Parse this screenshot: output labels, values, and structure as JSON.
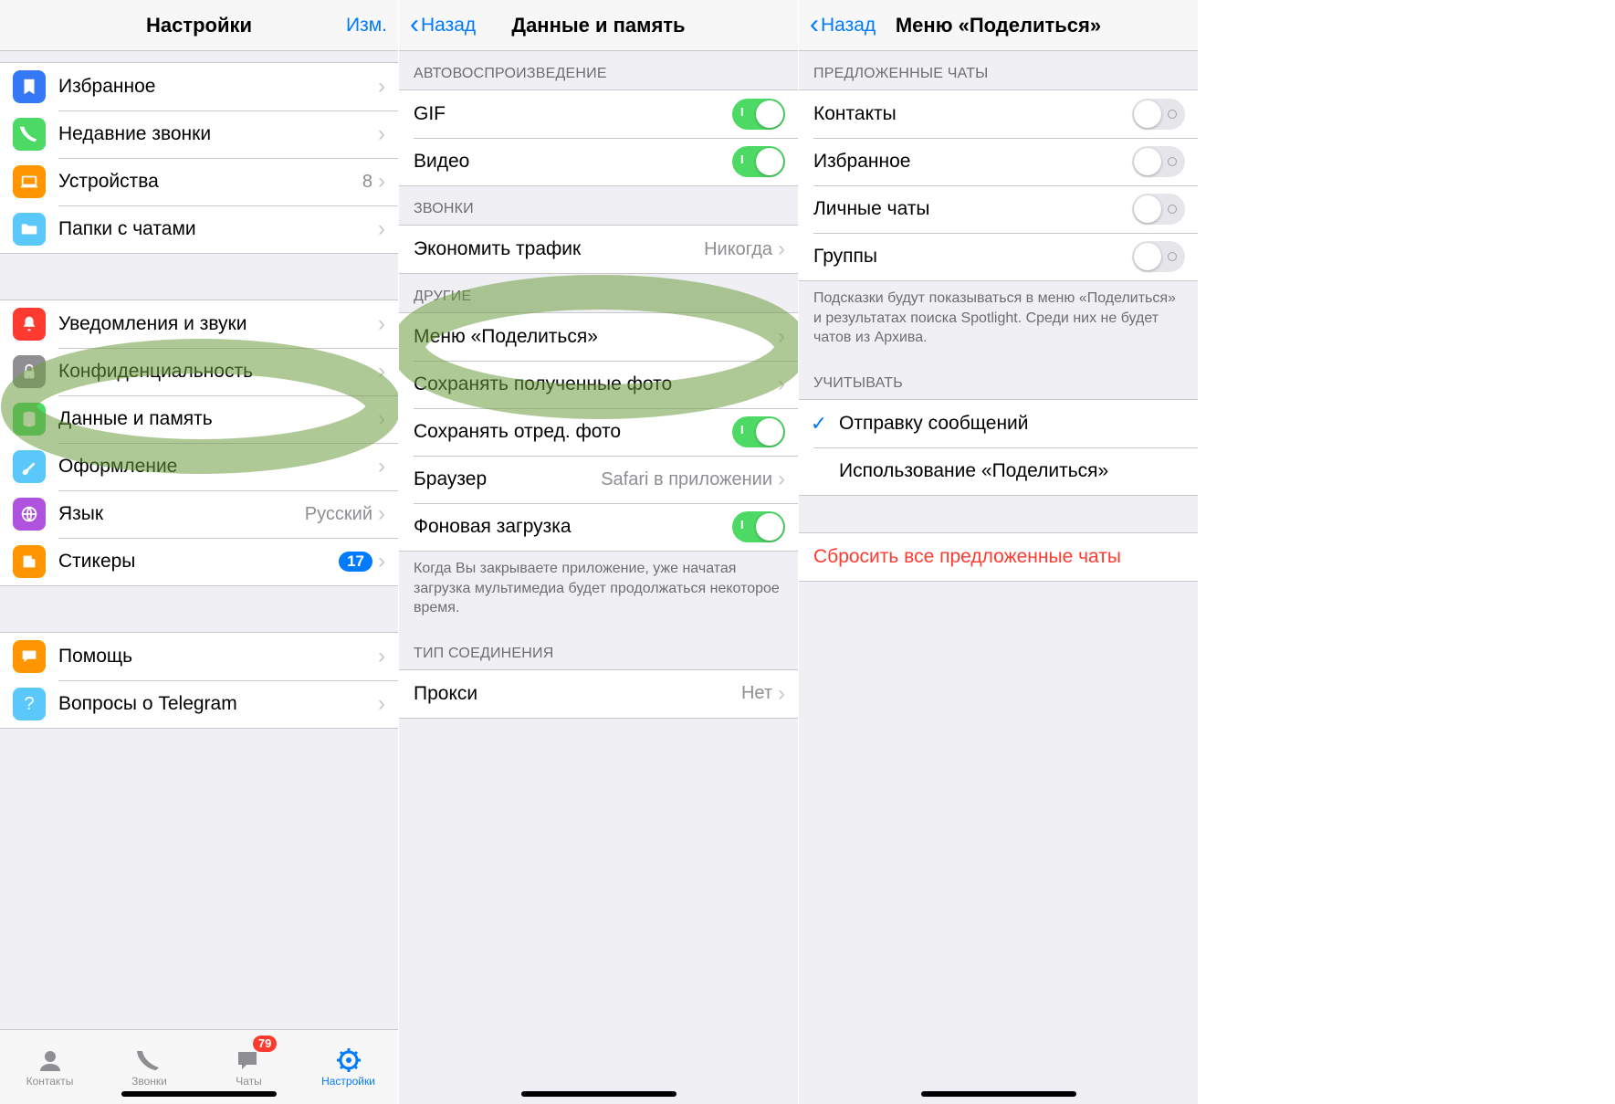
{
  "screen1": {
    "title": "Настройки",
    "edit": "Изм.",
    "group1": [
      {
        "id": "bookmark",
        "label": "Избранное"
      },
      {
        "id": "calls",
        "label": "Недавние звонки"
      },
      {
        "id": "devices",
        "label": "Устройства",
        "value": "8"
      },
      {
        "id": "folders",
        "label": "Папки с чатами"
      }
    ],
    "group2": [
      {
        "id": "notif",
        "label": "Уведомления и звуки"
      },
      {
        "id": "privacy",
        "label": "Конфиденциальность"
      },
      {
        "id": "data",
        "label": "Данные и память"
      },
      {
        "id": "appearance",
        "label": "Оформление"
      },
      {
        "id": "lang",
        "label": "Язык",
        "value": "Русский"
      },
      {
        "id": "stickers",
        "label": "Стикеры",
        "badge": "17"
      }
    ],
    "group3": [
      {
        "id": "help",
        "label": "Помощь"
      },
      {
        "id": "faq",
        "label": "Вопросы о Telegram"
      }
    ],
    "tabs": {
      "contacts": "Контакты",
      "calls": "Звонки",
      "chats": "Чаты",
      "settings": "Настройки",
      "chats_badge": "79"
    }
  },
  "screen2": {
    "back": "Назад",
    "title": "Данные и память",
    "sect_autoplay": "АВТОВОСПРОИЗВЕДЕНИЕ",
    "gif": "GIF",
    "video": "Видео",
    "sect_calls": "ЗВОНКИ",
    "save_traffic": "Экономить трафик",
    "save_traffic_val": "Никогда",
    "sect_other": "ДРУГИЕ",
    "share_menu": "Меню «Поделиться»",
    "save_received": "Сохранять полученные фото",
    "save_edited": "Сохранять отред. фото",
    "browser": "Браузер",
    "browser_val": "Safari в приложении",
    "bg_download": "Фоновая загрузка",
    "footer": "Когда Вы закрываете приложение, уже начатая загрузка мультимедиа будет продолжаться некоторое время.",
    "sect_conn": "ТИП СОЕДИНЕНИЯ",
    "proxy": "Прокси",
    "proxy_val": "Нет"
  },
  "screen3": {
    "back": "Назад",
    "title": "Меню «Поделиться»",
    "sect_suggested": "ПРЕДЛОЖЕННЫЕ ЧАТЫ",
    "contacts": "Контакты",
    "favorites": "Избранное",
    "private": "Личные чаты",
    "groups": "Группы",
    "footer1": "Подсказки будут показываться в меню «Поделиться» и результатах поиска Spotlight. Среди них не будет чатов из Архива.",
    "sect_consider": "УЧИТЫВАТЬ",
    "opt_send": "Отправку сообщений",
    "opt_share": "Использование «Поделиться»",
    "reset": "Сбросить все предложенные чаты"
  }
}
